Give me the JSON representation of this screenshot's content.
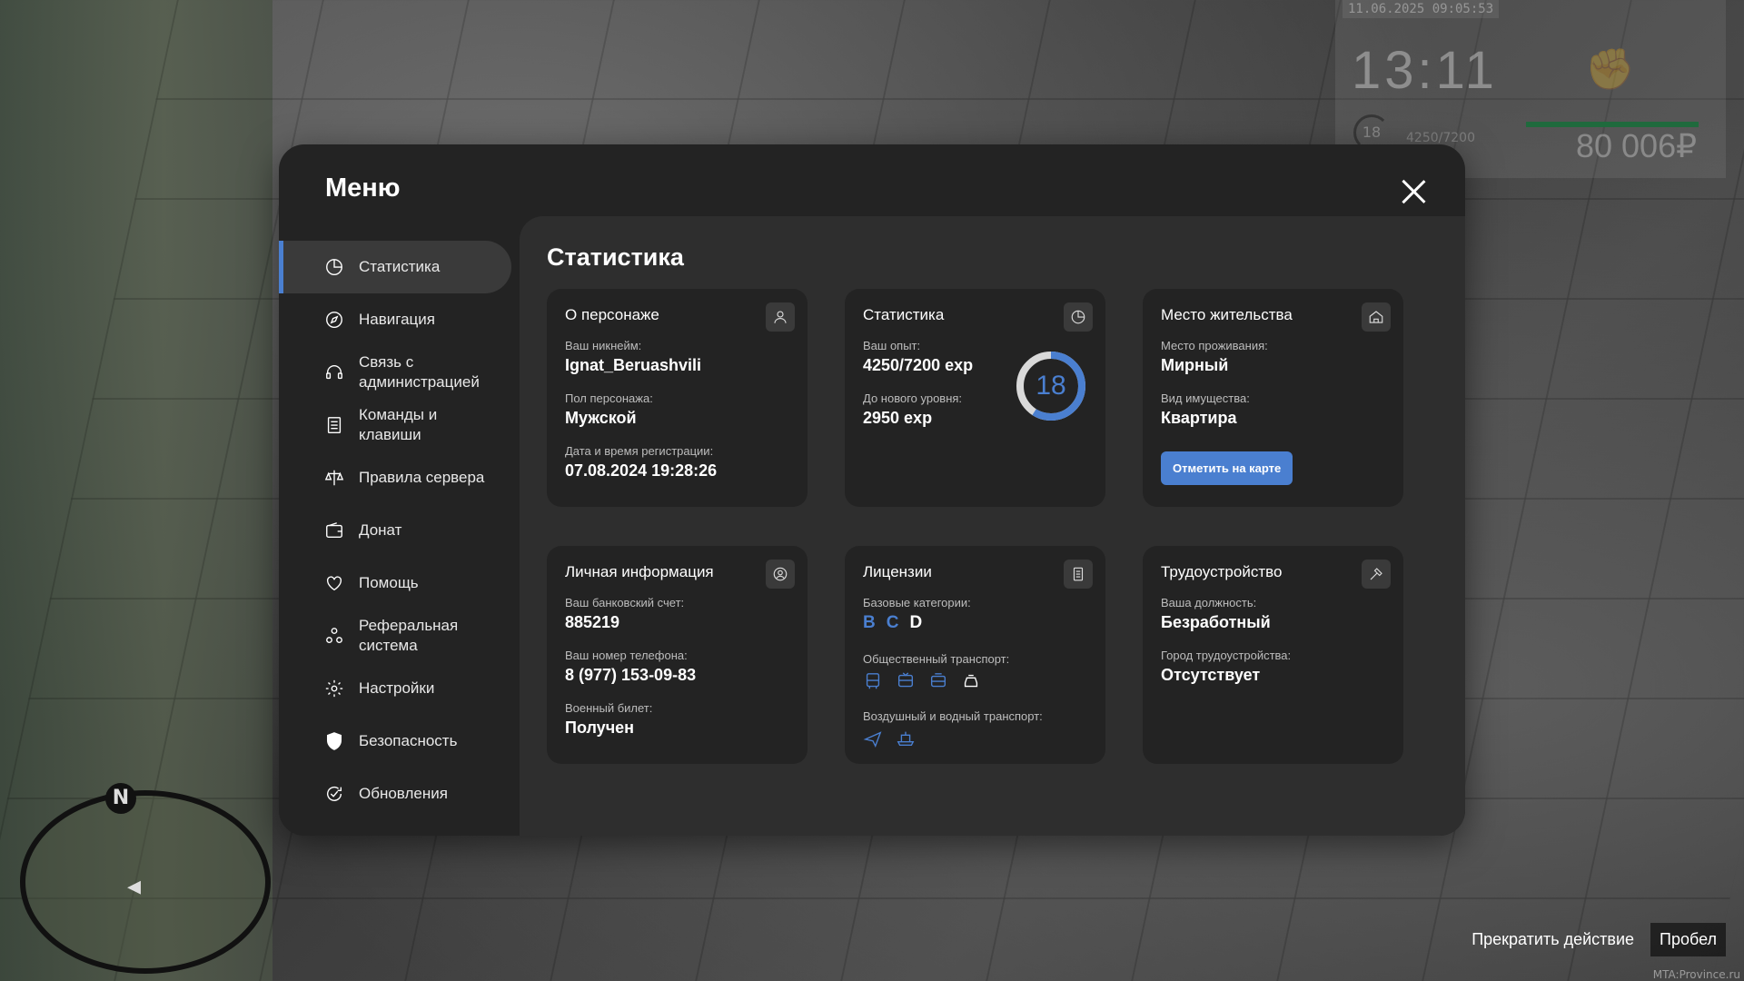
{
  "hud": {
    "date": "11.06.2025 09:05:53",
    "time": "13:11",
    "level": "18",
    "exp": "4250/7200",
    "money": "80 006₽"
  },
  "menu": {
    "title": "Меню",
    "items": [
      {
        "label": "Статистика",
        "icon": "pie-chart-icon"
      },
      {
        "label": "Навигация",
        "icon": "compass-icon"
      },
      {
        "label": "Связь с\nадминистрацией",
        "icon": "headset-icon"
      },
      {
        "label": "Команды и\nклавиши",
        "icon": "list-icon"
      },
      {
        "label": "Правила сервера",
        "icon": "scales-icon"
      },
      {
        "label": "Донат",
        "icon": "wallet-icon"
      },
      {
        "label": "Помощь",
        "icon": "handshake-heart-icon"
      },
      {
        "label": "Реферальная\nсистема",
        "icon": "referral-icon"
      },
      {
        "label": "Настройки",
        "icon": "gear-icon"
      },
      {
        "label": "Безопасность",
        "icon": "shield-icon"
      },
      {
        "label": "Обновления",
        "icon": "refresh-check-icon"
      }
    ]
  },
  "content": {
    "title": "Статистика",
    "character": {
      "title": "О персонаже",
      "nick_label": "Ваш никнейм:",
      "nick": "Ignat_Beruashvili",
      "gender_label": "Пол персонажа:",
      "gender": "Мужской",
      "reg_label": "Дата и время регистрации:",
      "reg": "07.08.2024 19:28:26"
    },
    "stats": {
      "title": "Статистика",
      "exp_label": "Ваш опыт:",
      "exp": "4250/7200 exp",
      "next_label": "До нового уровня:",
      "next": "2950 exp",
      "level": "18",
      "progress": 0.59
    },
    "residence": {
      "title": "Место жительства",
      "place_label": "Место проживания:",
      "place": "Мирный",
      "property_label": "Вид имущества:",
      "property": "Квартира",
      "button": "Отметить на карте"
    },
    "personal": {
      "title": "Личная информация",
      "bank_label": "Ваш банковский счет:",
      "bank": "885219",
      "phone_label": "Ваш номер телефона:",
      "phone": "8 (977) 153-09-83",
      "military_label": "Военный билет:",
      "military": "Получен"
    },
    "licenses": {
      "title": "Лицензии",
      "base_label": "Базовые категории:",
      "cats": [
        "B",
        "C",
        "D"
      ],
      "public_label": "Общественный транспорт:",
      "air_label": "Воздушный и водный транспорт:"
    },
    "employment": {
      "title": "Трудоустройство",
      "position_label": "Ваша должность:",
      "position": "Безработный",
      "city_label": "Город трудоустройства:",
      "city": "Отсутствует"
    }
  },
  "hint": {
    "action": "Прекратить действие",
    "key": "Пробел"
  },
  "watermark": "MTA:Province.ru",
  "colors": {
    "accent": "#4a7fd0",
    "panel": "#232323",
    "content": "#2e2e2e"
  }
}
